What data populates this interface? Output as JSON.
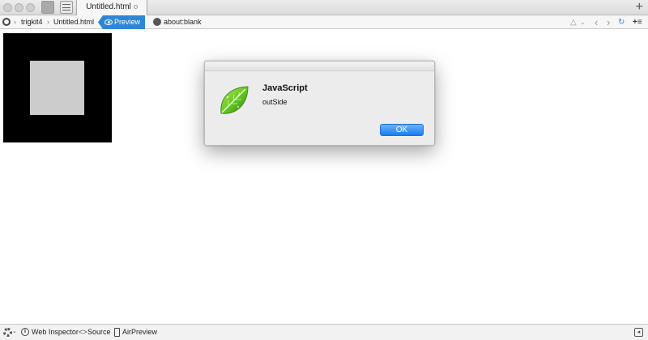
{
  "window": {
    "tab_title": "Untitled.html",
    "new_tab_symbol": "+"
  },
  "pathbar": {
    "crumbs": [
      "trigkit4",
      "Untitled.html"
    ],
    "preview_label": "Preview",
    "url": "about:blank",
    "more_symbol": "+≡"
  },
  "dialog": {
    "title": "JavaScript",
    "message": "outSide",
    "ok_label": "OK"
  },
  "statusbar": {
    "web_inspector": "Web Inspector",
    "source": "Source",
    "airpreview": "AirPreview"
  },
  "colors": {
    "accent": "#2e87d6",
    "ok_button": "#1b7df4",
    "content_outer": "#000000",
    "content_inner": "#cccccc"
  },
  "icons": [
    "traffic-light",
    "sidebar-toggle-icon",
    "layout-icon",
    "eye-icon",
    "globe-icon",
    "leaf-icon",
    "gear-icon",
    "info-icon",
    "code-icon",
    "phone-icon",
    "collapse-icon"
  ]
}
